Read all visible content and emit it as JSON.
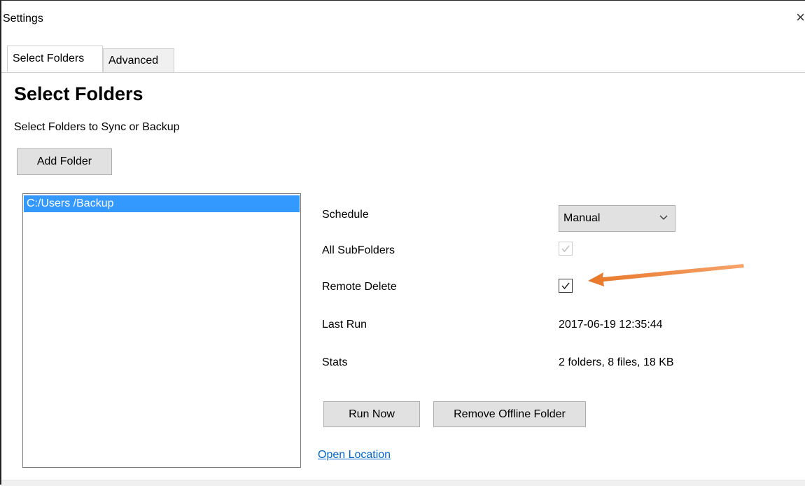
{
  "window": {
    "title": "Settings",
    "close_icon": "close-icon",
    "close_glyph": "×"
  },
  "tabs": [
    {
      "label": "Select Folders",
      "active": true
    },
    {
      "label": "Advanced",
      "active": false
    }
  ],
  "main": {
    "heading": "Select Folders",
    "subtitle": "Select Folders to Sync or Backup",
    "add_folder_label": "Add Folder",
    "folders": [
      {
        "path": "C:/Users            /Backup",
        "selected": true
      }
    ],
    "details": {
      "schedule_label": "Schedule",
      "schedule_value": "Manual",
      "schedule_icon": "chevron-down-icon",
      "subfolders_label": "All SubFolders",
      "subfolders_checked": true,
      "subfolders_enabled": false,
      "remote_delete_label": "Remote Delete",
      "remote_delete_checked": true,
      "last_run_label": "Last Run",
      "last_run_value": "2017-06-19 12:35:44",
      "stats_label": "Stats",
      "stats_value": "2 folders, 8 files, 18 KB"
    },
    "run_now_label": "Run Now",
    "remove_offline_label": "Remove Offline Folder",
    "open_location_label": "Open Location"
  },
  "colors": {
    "selection": "#3399ff",
    "link": "#0066cc",
    "button_face": "#e1e1e1",
    "annotation_arrow": "#f08b3a"
  }
}
